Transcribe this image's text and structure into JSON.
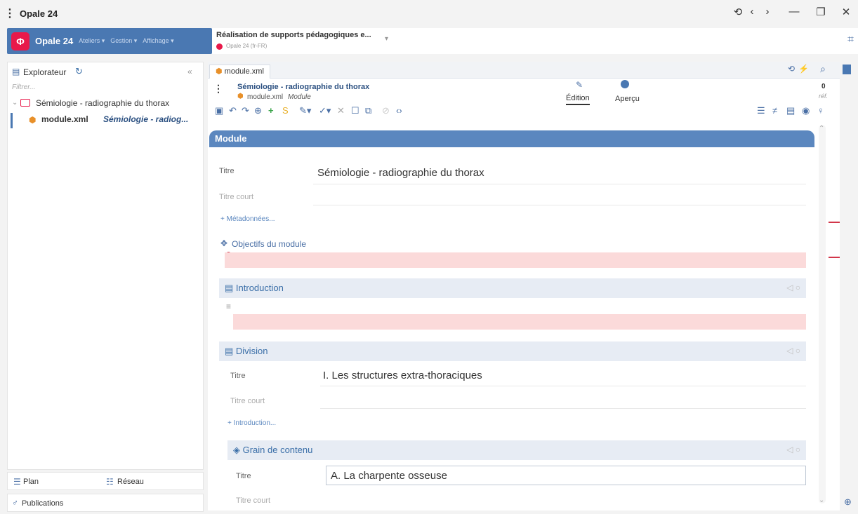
{
  "window": {
    "title": "Opale 24",
    "controls": [
      "⟲",
      "‹",
      "›",
      "—",
      "❐",
      "✕"
    ]
  },
  "appbar": {
    "name": "Opale 24",
    "menus": [
      "Ateliers ▾",
      "Gestion ▾",
      "Affichage ▾"
    ]
  },
  "project": {
    "title": "Réalisation de supports pédagogiques e...",
    "subtitle": "Opale 24 (fr-FR)"
  },
  "explorer": {
    "title": "Explorateur",
    "filter_placeholder": "Filtrer...",
    "folder": "Sémiologie - radiographie du thorax",
    "file_name": "module.xml",
    "file_title": "Sémiologie - radiog..."
  },
  "bottom_tabs": {
    "plan": "Plan",
    "reseau": "Réseau",
    "publications": "Publications"
  },
  "editor": {
    "tab": "module.xml",
    "doc_title": "Sémiologie - radiographie du thorax",
    "doc_sub_file": "module.xml",
    "doc_sub_type": "Module",
    "mode_edit": "Édition",
    "mode_preview": "Aperçu",
    "ref_count": "0",
    "ref_label": "réf."
  },
  "module": {
    "header": "Module",
    "titre_label": "Titre",
    "titre_value": "Sémiologie - radiographie du thorax",
    "titre_court_label": "Titre court",
    "metadata_link": "+ Métadonnées...",
    "objectifs_label": "Objectifs du module"
  },
  "introduction": {
    "title": "Introduction"
  },
  "division": {
    "title": "Division",
    "titre_label": "Titre",
    "titre_value": "I. Les structures extra-thoraciques",
    "titre_court_label": "Titre court",
    "intro_link": "+ Introduction..."
  },
  "grain": {
    "title": "Grain de contenu",
    "titre_label": "Titre",
    "titre_value": "A. La charpente osseuse",
    "titre_court_label": "Titre court"
  },
  "colors": {
    "accent": "#5b87bf",
    "error": "#d2364a",
    "brand": "#e8194a"
  }
}
